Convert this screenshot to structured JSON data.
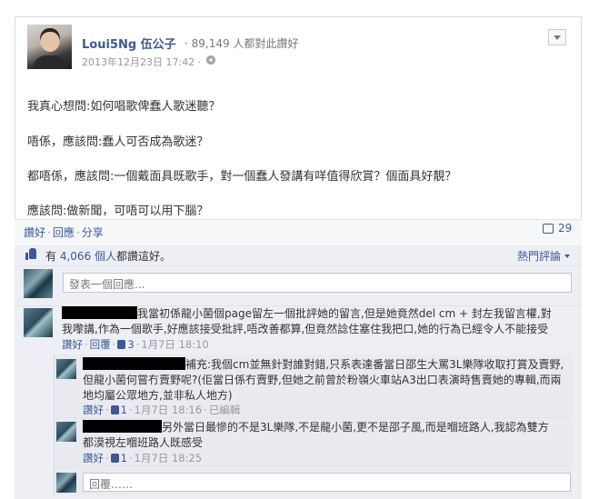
{
  "post": {
    "page_name": "Loui5Ng 伍公子",
    "likes_line": "· 89,149 人都對此讚好",
    "timestamp": "2013年12月23日 17:42 ·",
    "lines": [
      "我真心想問:如何唱歌俾蠢人歌迷聽？",
      "唔係，應該問:蠢人可否成為歌迷？",
      "都唔係，應該問:一個戴面具既歌手，對一個蠢人發講有咩值得欣賞？個面具好靚？",
      "應該問:做新聞，可唔可以用下腦？"
    ]
  },
  "actions": {
    "like": "讚好",
    "comment": "回應",
    "share": "分享",
    "comment_count": "29"
  },
  "likes_summary": {
    "prefix": "有",
    "count": "4,066 個人",
    "suffix": "都讚這好。",
    "sort": "熱門評論"
  },
  "compose": {
    "placeholder": "發表一個回應..."
  },
  "comments": [
    {
      "line1": "我當初係龍小菌個page留左一個批評她的留言,但是她竟然del cm + 封左我留言權,對",
      "line2": "我嚟講,作為一個歌手,好應該接受批評,唔改善都算,但竟然諗住塞住我把口,她的行為已經令人不能接受",
      "like": "讚好",
      "reply": "回覆",
      "likes": "3",
      "date": "1月7日 18:10"
    }
  ],
  "replies": [
    {
      "line1": "補充:我個cm並無針對誰對錯,只系表達番當日邵生大罵3L樂隊收取打賞及賣野,",
      "line2": "但龍小菌何嘗冇賣野呢?(佢當日係冇賣野,但她之前曾於粉嶺火車站A3出口表演時售賣她的專輯,而兩",
      "line3": "地均屬公眾地方,並非私人地方)",
      "like": "讚好",
      "likes": "1",
      "date": "1月7日 18:16",
      "edited": "已編輯"
    },
    {
      "line1": "另外當日最慘的不是3L樂隊,不是龍小菌,更不是邵子風,而是嗰班路人,我認為雙方",
      "line2": "都漠視左嗰班路人既感受",
      "like": "讚好",
      "likes": "1",
      "date": "1月7日 18:25"
    }
  ],
  "reply_compose": {
    "placeholder": "回覆……"
  }
}
